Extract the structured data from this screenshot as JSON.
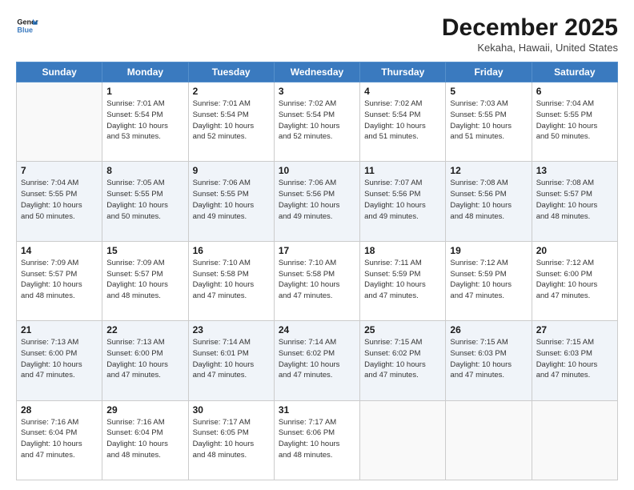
{
  "logo": {
    "line1": "General",
    "line2": "Blue"
  },
  "title": "December 2025",
  "location": "Kekaha, Hawaii, United States",
  "weekdays": [
    "Sunday",
    "Monday",
    "Tuesday",
    "Wednesday",
    "Thursday",
    "Friday",
    "Saturday"
  ],
  "weeks": [
    [
      {
        "day": null,
        "info": null
      },
      {
        "day": "1",
        "info": "Sunrise: 7:01 AM\nSunset: 5:54 PM\nDaylight: 10 hours\nand 53 minutes."
      },
      {
        "day": "2",
        "info": "Sunrise: 7:01 AM\nSunset: 5:54 PM\nDaylight: 10 hours\nand 52 minutes."
      },
      {
        "day": "3",
        "info": "Sunrise: 7:02 AM\nSunset: 5:54 PM\nDaylight: 10 hours\nand 52 minutes."
      },
      {
        "day": "4",
        "info": "Sunrise: 7:02 AM\nSunset: 5:54 PM\nDaylight: 10 hours\nand 51 minutes."
      },
      {
        "day": "5",
        "info": "Sunrise: 7:03 AM\nSunset: 5:55 PM\nDaylight: 10 hours\nand 51 minutes."
      },
      {
        "day": "6",
        "info": "Sunrise: 7:04 AM\nSunset: 5:55 PM\nDaylight: 10 hours\nand 50 minutes."
      }
    ],
    [
      {
        "day": "7",
        "info": "Sunrise: 7:04 AM\nSunset: 5:55 PM\nDaylight: 10 hours\nand 50 minutes."
      },
      {
        "day": "8",
        "info": "Sunrise: 7:05 AM\nSunset: 5:55 PM\nDaylight: 10 hours\nand 50 minutes."
      },
      {
        "day": "9",
        "info": "Sunrise: 7:06 AM\nSunset: 5:55 PM\nDaylight: 10 hours\nand 49 minutes."
      },
      {
        "day": "10",
        "info": "Sunrise: 7:06 AM\nSunset: 5:56 PM\nDaylight: 10 hours\nand 49 minutes."
      },
      {
        "day": "11",
        "info": "Sunrise: 7:07 AM\nSunset: 5:56 PM\nDaylight: 10 hours\nand 49 minutes."
      },
      {
        "day": "12",
        "info": "Sunrise: 7:08 AM\nSunset: 5:56 PM\nDaylight: 10 hours\nand 48 minutes."
      },
      {
        "day": "13",
        "info": "Sunrise: 7:08 AM\nSunset: 5:57 PM\nDaylight: 10 hours\nand 48 minutes."
      }
    ],
    [
      {
        "day": "14",
        "info": "Sunrise: 7:09 AM\nSunset: 5:57 PM\nDaylight: 10 hours\nand 48 minutes."
      },
      {
        "day": "15",
        "info": "Sunrise: 7:09 AM\nSunset: 5:57 PM\nDaylight: 10 hours\nand 48 minutes."
      },
      {
        "day": "16",
        "info": "Sunrise: 7:10 AM\nSunset: 5:58 PM\nDaylight: 10 hours\nand 47 minutes."
      },
      {
        "day": "17",
        "info": "Sunrise: 7:10 AM\nSunset: 5:58 PM\nDaylight: 10 hours\nand 47 minutes."
      },
      {
        "day": "18",
        "info": "Sunrise: 7:11 AM\nSunset: 5:59 PM\nDaylight: 10 hours\nand 47 minutes."
      },
      {
        "day": "19",
        "info": "Sunrise: 7:12 AM\nSunset: 5:59 PM\nDaylight: 10 hours\nand 47 minutes."
      },
      {
        "day": "20",
        "info": "Sunrise: 7:12 AM\nSunset: 6:00 PM\nDaylight: 10 hours\nand 47 minutes."
      }
    ],
    [
      {
        "day": "21",
        "info": "Sunrise: 7:13 AM\nSunset: 6:00 PM\nDaylight: 10 hours\nand 47 minutes."
      },
      {
        "day": "22",
        "info": "Sunrise: 7:13 AM\nSunset: 6:00 PM\nDaylight: 10 hours\nand 47 minutes."
      },
      {
        "day": "23",
        "info": "Sunrise: 7:14 AM\nSunset: 6:01 PM\nDaylight: 10 hours\nand 47 minutes."
      },
      {
        "day": "24",
        "info": "Sunrise: 7:14 AM\nSunset: 6:02 PM\nDaylight: 10 hours\nand 47 minutes."
      },
      {
        "day": "25",
        "info": "Sunrise: 7:15 AM\nSunset: 6:02 PM\nDaylight: 10 hours\nand 47 minutes."
      },
      {
        "day": "26",
        "info": "Sunrise: 7:15 AM\nSunset: 6:03 PM\nDaylight: 10 hours\nand 47 minutes."
      },
      {
        "day": "27",
        "info": "Sunrise: 7:15 AM\nSunset: 6:03 PM\nDaylight: 10 hours\nand 47 minutes."
      }
    ],
    [
      {
        "day": "28",
        "info": "Sunrise: 7:16 AM\nSunset: 6:04 PM\nDaylight: 10 hours\nand 47 minutes."
      },
      {
        "day": "29",
        "info": "Sunrise: 7:16 AM\nSunset: 6:04 PM\nDaylight: 10 hours\nand 48 minutes."
      },
      {
        "day": "30",
        "info": "Sunrise: 7:17 AM\nSunset: 6:05 PM\nDaylight: 10 hours\nand 48 minutes."
      },
      {
        "day": "31",
        "info": "Sunrise: 7:17 AM\nSunset: 6:06 PM\nDaylight: 10 hours\nand 48 minutes."
      },
      {
        "day": null,
        "info": null
      },
      {
        "day": null,
        "info": null
      },
      {
        "day": null,
        "info": null
      }
    ]
  ]
}
